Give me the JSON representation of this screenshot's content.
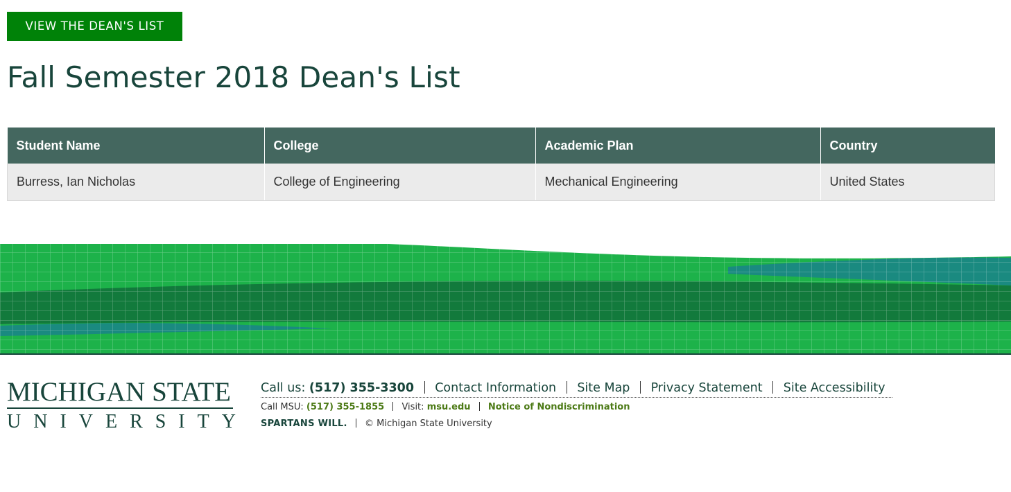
{
  "cta": {
    "label": "VIEW THE DEAN'S LIST"
  },
  "page_title": "Fall Semester 2018 Dean's List",
  "table": {
    "headers": [
      "Student Name",
      "College",
      "Academic Plan",
      "Country"
    ],
    "rows": [
      [
        "Burress, Ian Nicholas",
        "College of Engineering",
        "Mechanical Engineering",
        "United States"
      ]
    ]
  },
  "logo": {
    "line1": "MICHIGAN STATE",
    "line2_letters": [
      "U",
      "N",
      "I",
      "V",
      "E",
      "R",
      "S",
      "I",
      "T",
      "Y"
    ]
  },
  "footer": {
    "call_label": "Call us:",
    "call_number": "(517) 355-3300",
    "links": [
      "Contact Information",
      "Site Map",
      "Privacy Statement",
      "Site Accessibility"
    ],
    "call_msu_label": "Call MSU:",
    "call_msu_number": "(517) 355-1855",
    "visit_label": "Visit:",
    "visit_link": "msu.edu",
    "nondiscrimination": "Notice of Nondiscrimination",
    "spartans": "SPARTANS WILL.",
    "copyright": "© Michigan State University"
  },
  "colors": {
    "msu_green": "#18453b",
    "button_green": "#008208",
    "header_bg": "#44675f",
    "link_green": "#4c7a16"
  }
}
